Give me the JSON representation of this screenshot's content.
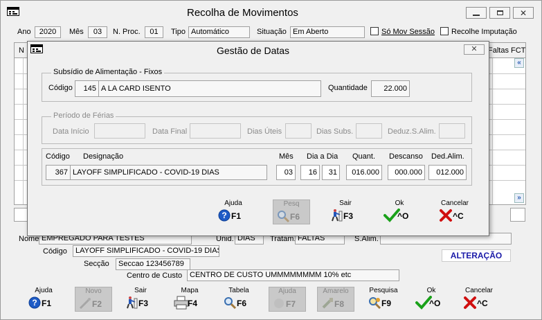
{
  "main_window": {
    "title": "Recolha de Movimentos",
    "header": {
      "ano_label": "Ano",
      "ano_value": "2020",
      "mes_label": "Mês",
      "mes_value": "03",
      "nproc_label": "N. Proc.",
      "nproc_value": "01",
      "tipo_label": "Tipo",
      "tipo_value": "Automático",
      "situacao_label": "Situação",
      "situacao_value": "Em Aberto",
      "so_mov_label": "Só Mov Sessão",
      "recolhe_label": "Recolhe Imputação"
    },
    "grid": {
      "col_n": "N",
      "col_faltas": "Faltas FCT"
    },
    "details": {
      "nome_label": "Nome",
      "nome_value": "EMPREGADO PARA TESTES",
      "unid_label": "Unid.",
      "unid_value": "DIAS",
      "tratam_label": "Tratam.",
      "tratam_value": "FALTAS",
      "salim_label": "S.Alim.",
      "codigo_label": "Código",
      "codigo_value": "LAYOFF SIMPLIFICADO - COVID-19 DIAS",
      "seccao_label": "Secção",
      "seccao_value": "Seccao 123456789",
      "centro_label": "Centro de Custo",
      "centro_value": "CENTRO DE CUSTO UMMMMMMMM 10% etc",
      "status": "ALTERAÇÃO"
    },
    "toolbar": [
      {
        "caption": "Ajuda",
        "key": "F1",
        "icon": "help-icon",
        "enabled": true
      },
      {
        "caption": "Novo",
        "key": "F2",
        "icon": "new-icon",
        "enabled": false
      },
      {
        "caption": "Sair",
        "key": "F3",
        "icon": "exit-icon",
        "enabled": true
      },
      {
        "caption": "Mapa",
        "key": "F4",
        "icon": "printer-icon",
        "enabled": true
      },
      {
        "caption": "Tabela",
        "key": "F6",
        "icon": "table-search-icon",
        "enabled": true
      },
      {
        "caption": "Ajuda",
        "key": "F7",
        "icon": "help-disabled-icon",
        "enabled": false
      },
      {
        "caption": "Amarelo",
        "key": "F8",
        "icon": "paint-icon",
        "enabled": false
      },
      {
        "caption": "Pesquisa",
        "key": "F9",
        "icon": "search-icon",
        "enabled": true
      },
      {
        "caption": "Ok",
        "key": "^O",
        "icon": "ok-check-icon",
        "enabled": true
      },
      {
        "caption": "Cancelar",
        "key": "^C",
        "icon": "cancel-x-icon",
        "enabled": true
      }
    ]
  },
  "dialog": {
    "title": "Gestão de Datas",
    "subsidio": {
      "group_title": "Subsídio de Alimentação - Fixos",
      "codigo_label": "Código",
      "codigo_num": "145",
      "codigo_desc": "A LA CARD ISENTO",
      "quantidade_label": "Quantidade",
      "quantidade_value": "22.000"
    },
    "ferias": {
      "group_title": "Período de Férias",
      "data_inicio_label": "Data Início",
      "data_final_label": "Data Final",
      "dias_uteis_label": "Dias Úteis",
      "dias_subs_label": "Dias Subs.",
      "deduz_label": "Deduz.S.Alim."
    },
    "linha": {
      "codigo_label": "Código",
      "designacao_label": "Designação",
      "mes_label": "Mês",
      "dia_label": "Dia a Dia",
      "quant_label": "Quant.",
      "descanso_label": "Descanso",
      "ded_label": "Ded.Alim.",
      "codigo_value": "367",
      "designacao_value": "LAYOFF SIMPLIFICADO - COVID-19 DIAS",
      "mes_value": "03",
      "dia_de": "16",
      "dia_a": "31",
      "quant_value": "016.000",
      "descanso_value": "000.000",
      "ded_value": "012.000"
    },
    "buttons": [
      {
        "caption": "Ajuda",
        "key": "F1",
        "icon": "help-icon",
        "enabled": true
      },
      {
        "caption": "Pesq",
        "key": "F6",
        "icon": "search-disabled-icon",
        "enabled": false
      },
      {
        "caption": "Sair",
        "key": "F3",
        "icon": "exit-icon",
        "enabled": true
      },
      {
        "caption": "Ok",
        "key": "^O",
        "icon": "ok-check-icon",
        "enabled": true
      },
      {
        "caption": "Cancelar",
        "key": "^C",
        "icon": "cancel-x-icon",
        "enabled": true
      }
    ],
    "close_glyph": "✕"
  },
  "colors": {
    "status_blue": "#1a1aa8",
    "ok_green": "#1aa11a",
    "cancel_red": "#d01010",
    "help_blue": "#1e5bc6"
  }
}
